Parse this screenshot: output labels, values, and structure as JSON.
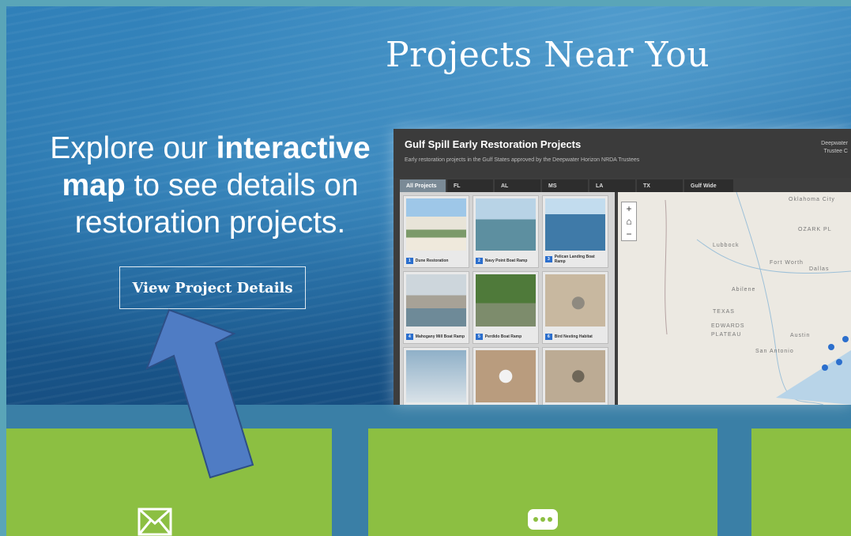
{
  "hero": {
    "title": "Projects Near You",
    "intro_part1": "Explore our ",
    "intro_bold1": "interactive",
    "intro_bold2": "map",
    "intro_part2": " to see details on restoration projects.",
    "button_label": "View Project Details"
  },
  "map_app": {
    "title": "Gulf Spill Early Restoration Projects",
    "subtitle": "Early restoration projects in the Gulf States approved by the Deepwater Horizon NRDA Trustees",
    "credit_line1": "Deepwater",
    "credit_line2": "Trustee C",
    "tabs": [
      "All Projects",
      "FL",
      "AL",
      "MS",
      "LA",
      "TX",
      "Gulf Wide"
    ],
    "projects": [
      {
        "badge": "1",
        "label": "Dune Restoration"
      },
      {
        "badge": "2",
        "label": "Navy Point Boat Ramp"
      },
      {
        "badge": "3",
        "label": "Pelican Landing Boat Ramp"
      },
      {
        "badge": "4",
        "label": "Mahogany Mill Boat Ramp"
      },
      {
        "badge": "5",
        "label": "Perdido Boat Ramp"
      },
      {
        "badge": "6",
        "label": "Bird Nesting Habitat"
      }
    ],
    "map_labels": [
      "TEXAS",
      "EDWARDS",
      "PLATEAU",
      "OZARK PL",
      "Fort Worth",
      "Dallas",
      "Austin",
      "San Antonio",
      "Oklahoma City",
      "Lubbock",
      "Abilene"
    ],
    "zoom_controls": [
      "+",
      "⌂",
      "−"
    ]
  },
  "tiles": {
    "left_icon": "envelope-icon",
    "middle_icon": "chat-bubble-icon"
  },
  "colors": {
    "tile_green": "#8cbf42",
    "arrow_blue": "#4f7cc4",
    "badge_blue": "#2c6fcd"
  }
}
